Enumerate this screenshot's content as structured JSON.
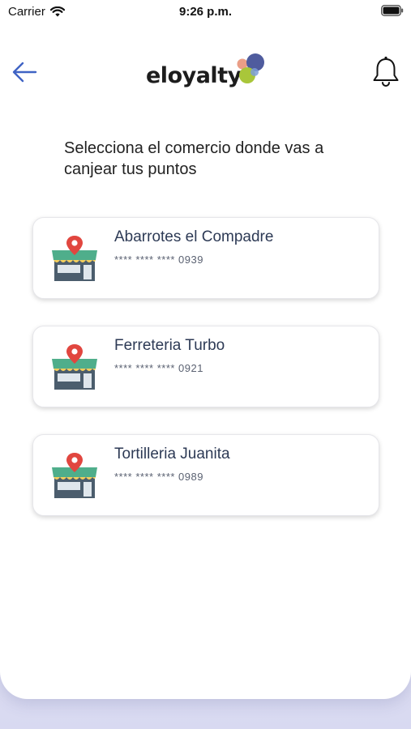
{
  "status_bar": {
    "carrier": "Carrier",
    "time": "9:26 p.m."
  },
  "header": {
    "logo_text": "eloyalty",
    "back_icon": "arrow-left-icon",
    "notifications_icon": "bell-icon"
  },
  "instruction": "Selecciona el comercio donde vas a canjear tus puntos",
  "stores": [
    {
      "name": "Abarrotes el Compadre",
      "card": "**** **** **** 0939",
      "icon": "store-location-icon"
    },
    {
      "name": "Ferreteria Turbo",
      "card": "**** **** **** 0921",
      "icon": "store-location-icon"
    },
    {
      "name": "Tortilleria Juanita",
      "card": "**** **** **** 0989",
      "icon": "store-location-icon"
    }
  ],
  "colors": {
    "accent_blue": "#3f63c4",
    "store_awning_green": "#4fae8b",
    "store_pin_red": "#e1463f",
    "awning_yellow": "#f2cd5c",
    "store_name": "#2d3a55"
  }
}
